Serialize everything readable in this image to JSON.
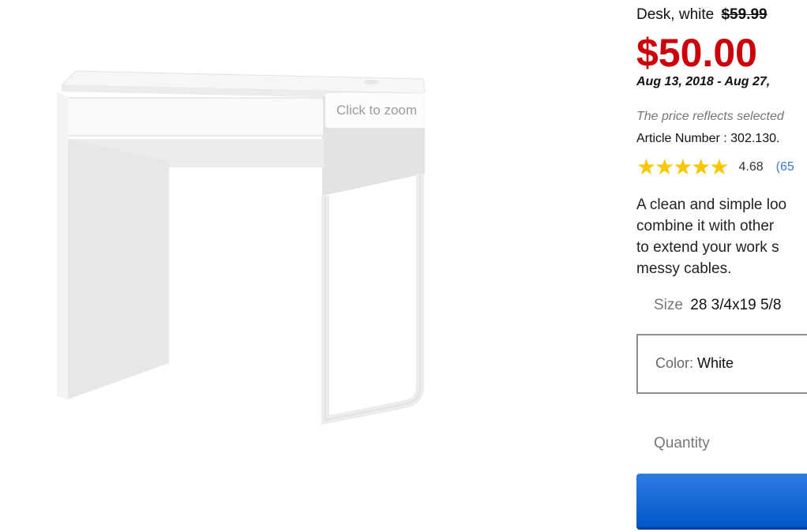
{
  "product": {
    "name": "Desk, white",
    "old_price": "$59.99",
    "price": "$50.00",
    "date_range": "Aug 13, 2018 - Aug 27,",
    "price_note": "The price reflects selected",
    "article_label": "Article Number :",
    "article_number": "302.130.",
    "stars": "★★★★★",
    "rating_value": "4.68",
    "review_count": "(65",
    "description_lines": [
      "A clean and simple loo",
      "combine it with other",
      "to extend your work s",
      "messy cables."
    ],
    "size_label": "Size",
    "size_value": "28 3/4x19 5/8",
    "color_label": "Color:",
    "color_value": "White",
    "quantity_label": "Quantity"
  },
  "gallery": {
    "zoom_hint": "Click to zoom"
  },
  "colors": {
    "price_red": "#cc0008",
    "star_yellow": "#f7c800",
    "link_blue": "#3a7dd4",
    "button_blue": "#0058c8"
  },
  "icons": {
    "rating": "star-icon"
  }
}
